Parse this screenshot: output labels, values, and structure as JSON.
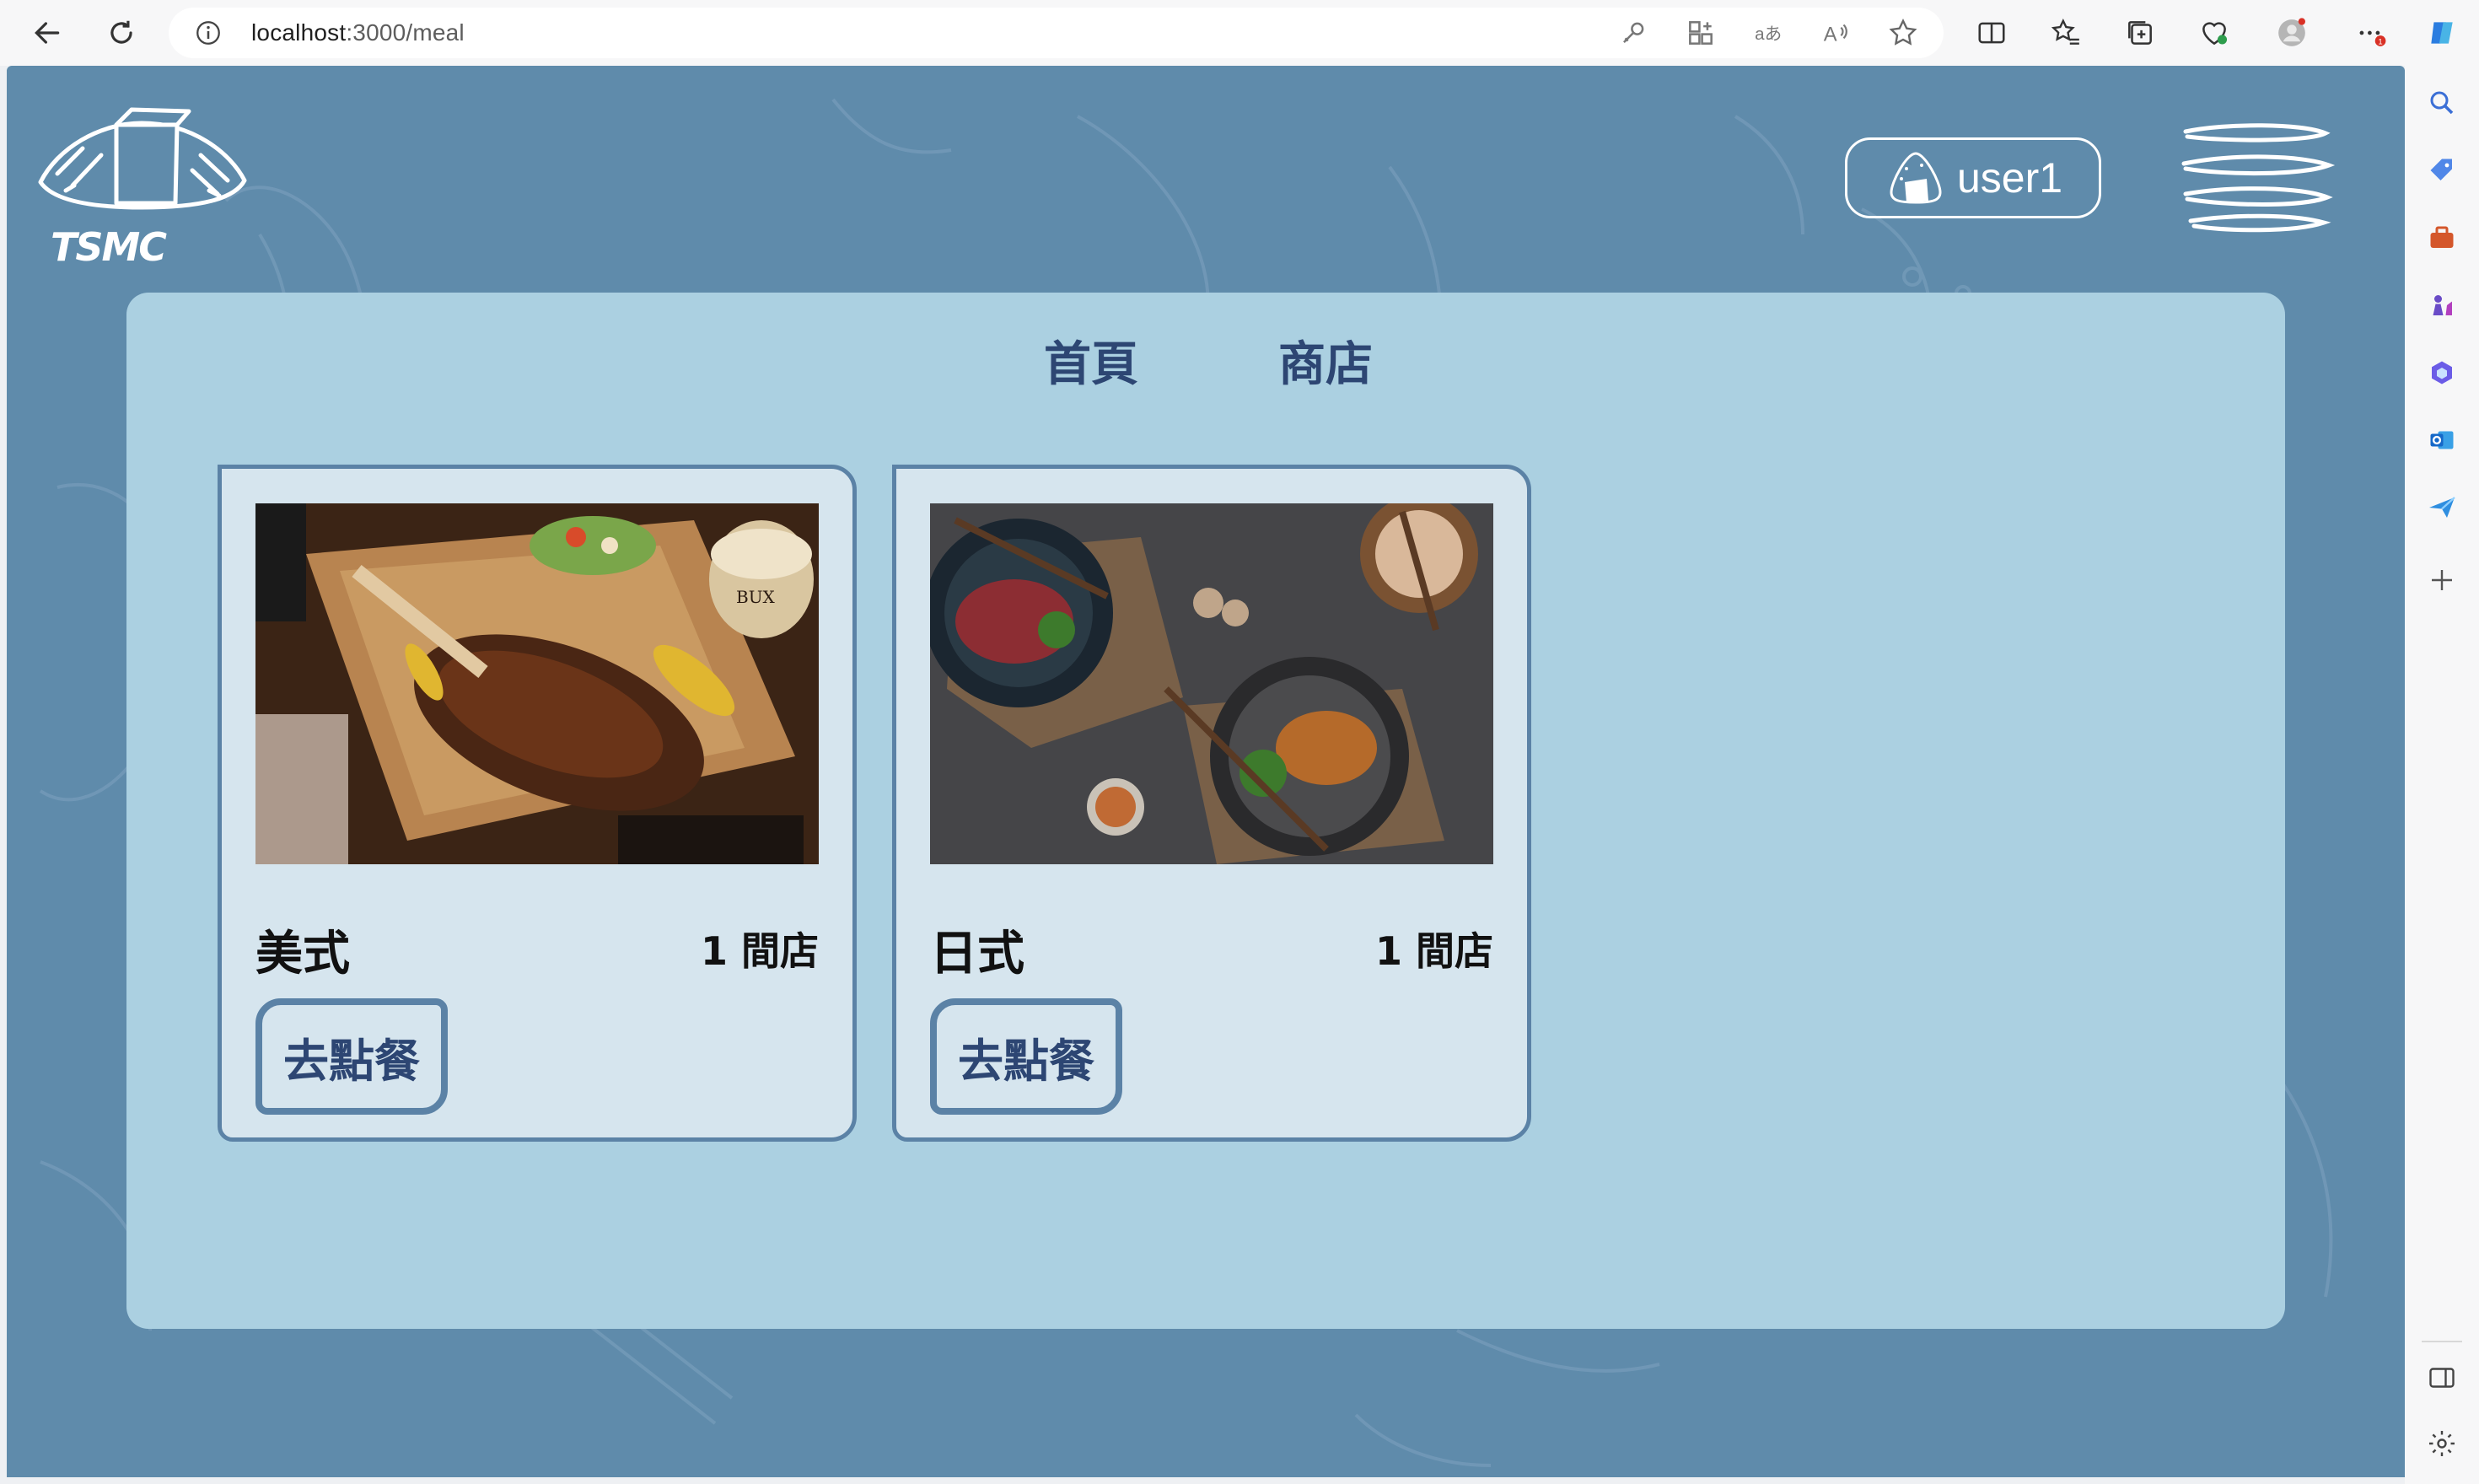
{
  "browser": {
    "url_host": "localhost",
    "url_rest": ":3000/meal"
  },
  "app": {
    "logo_text": "TSMC",
    "user_name": "user1"
  },
  "nav": {
    "items": [
      {
        "label": "首頁"
      },
      {
        "label": "商店"
      }
    ]
  },
  "cards": [
    {
      "title": "美式",
      "count": "1 間店",
      "button": "去點餐",
      "image": "american-steak-platter"
    },
    {
      "title": "日式",
      "count": "1 間店",
      "button": "去點餐",
      "image": "japanese-bowls"
    }
  ],
  "colors": {
    "page_bg": "#5f8bab",
    "panel_bg": "#abd0e1",
    "card_bg": "#d6e5ee",
    "card_border": "#5b82a6",
    "nav_text": "#2d4673"
  }
}
